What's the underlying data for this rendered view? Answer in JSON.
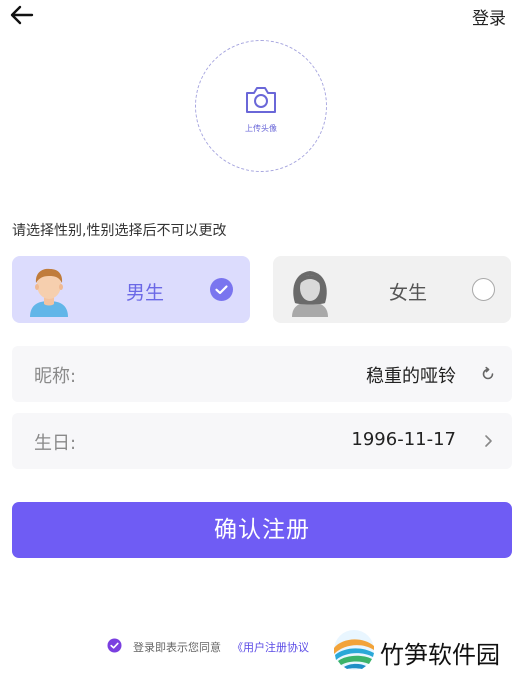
{
  "header": {
    "login_label": "登录"
  },
  "avatar_upload": {
    "label": "上传头像"
  },
  "gender": {
    "hint": "请选择性别,性别选择后不可以更改",
    "options": [
      {
        "label": "男生",
        "selected": true
      },
      {
        "label": "女生",
        "selected": false
      }
    ]
  },
  "form": {
    "nickname": {
      "label": "昵称:",
      "value": "稳重的哑铃"
    },
    "birthday": {
      "label": "生日:",
      "value": "1996-11-17"
    }
  },
  "confirm_button": {
    "label": "确认注册"
  },
  "agreement": {
    "checked": true,
    "text": "登录即表示您同意",
    "link": "《用户注册协议"
  },
  "watermark": {
    "text": "竹笋软件园"
  },
  "colors": {
    "accent": "#6f5cf4",
    "selected_bg": "#dcdcfd",
    "field_bg": "#f7f7f9"
  }
}
